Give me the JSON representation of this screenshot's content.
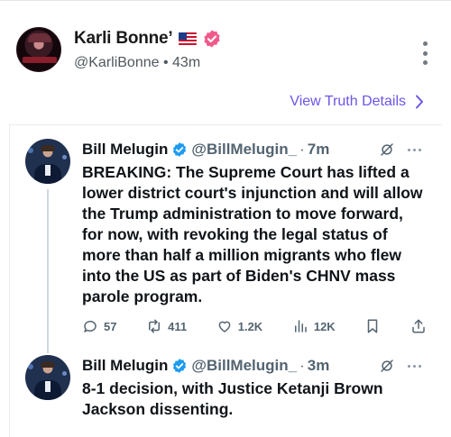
{
  "post": {
    "display_name": "Karli Bonne’",
    "handle": "@KarliBonne",
    "separator": "•",
    "time": "43m",
    "avatar_text": "Karli Bonne"
  },
  "details_link": {
    "label": "View Truth Details"
  },
  "quote": {
    "tweets": [
      {
        "name": "Bill Melugin",
        "handle": "@BillMelugin_",
        "separator": "·",
        "time": "7m",
        "text": "BREAKING: The Supreme Court has lifted a lower district court's injunction and will allow the Trump administration to move forward, for now, with revoking the legal status of more than half a million migrants who flew into the US as part of Biden's CHNV mass parole program.",
        "stats": {
          "replies": "57",
          "reposts": "411",
          "likes": "1.2K",
          "views": "12K"
        }
      },
      {
        "name": "Bill Melugin",
        "handle": "@BillMelugin_",
        "separator": "·",
        "time": "3m",
        "text": "8-1 decision, with Justice Ketanji Brown Jackson dissenting."
      }
    ]
  },
  "colors": {
    "link": "#6b55e6",
    "verified_truth": "#ef5a8a",
    "verified_x": "#1d9bf0",
    "muted": "#536471"
  },
  "icons": {
    "more": "more-vertical-icon",
    "chevron": "chevron-right-icon",
    "verified": "verified-badge-icon",
    "reply": "reply-icon",
    "repost": "repost-icon",
    "like": "heart-icon",
    "views": "views-icon",
    "bookmark": "bookmark-icon",
    "share": "share-icon",
    "grok": "grok-icon"
  }
}
